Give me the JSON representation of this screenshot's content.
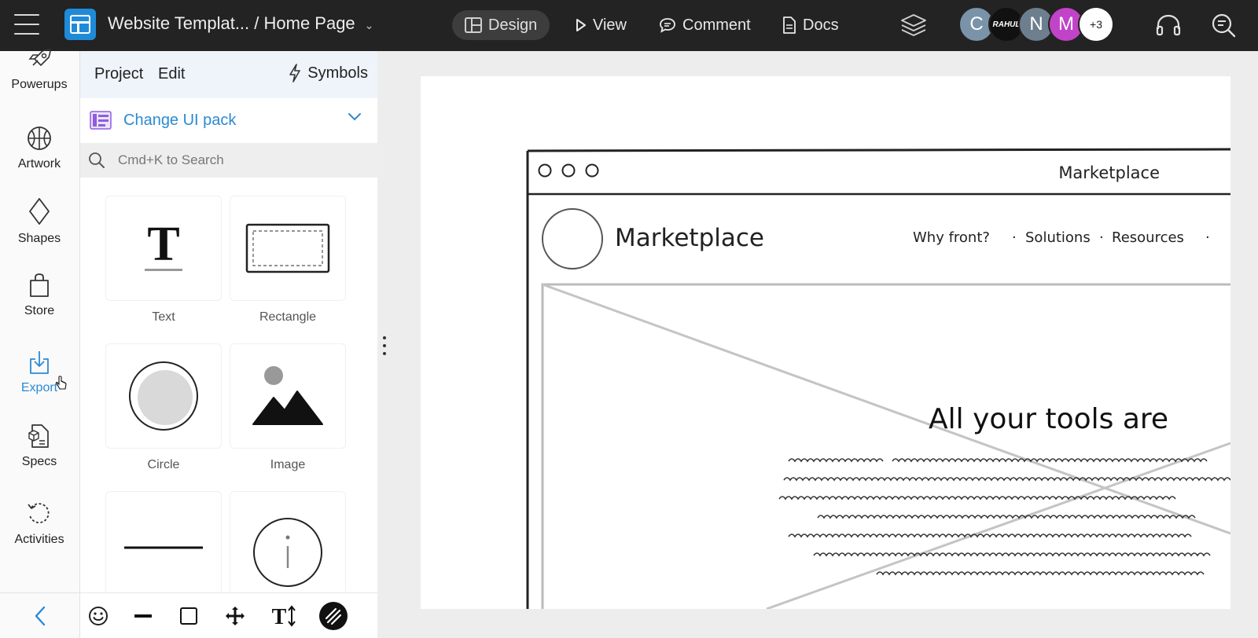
{
  "topbar": {
    "doc_title": "Website Templat... / Home Page",
    "modes": [
      {
        "label": "Design",
        "icon": "layout-icon"
      },
      {
        "label": "View",
        "icon": "play-icon"
      },
      {
        "label": "Comment",
        "icon": "comment-icon"
      },
      {
        "label": "Docs",
        "icon": "document-icon"
      }
    ],
    "avatars": [
      {
        "initial": "C",
        "color": "#7a93a8"
      },
      {
        "initial": "RAHUL",
        "color": "#111111"
      },
      {
        "initial": "N",
        "color": "#6d7f8f"
      },
      {
        "initial": "M",
        "color": "#c143c8"
      }
    ],
    "more_avatars": "+3"
  },
  "rail": {
    "items": [
      {
        "label": "Powerups",
        "icon": "rocket-icon"
      },
      {
        "label": "Artwork",
        "icon": "basketball-icon"
      },
      {
        "label": "Shapes",
        "icon": "diamond-icon"
      },
      {
        "label": "Store",
        "icon": "shopping-bag-icon"
      },
      {
        "label": "Export",
        "icon": "export-icon"
      },
      {
        "label": "Specs",
        "icon": "specs-icon"
      },
      {
        "label": "Activities",
        "icon": "history-icon"
      }
    ]
  },
  "panel": {
    "tabs": [
      "Project",
      "Edit"
    ],
    "symbols_label": "Symbols",
    "ui_pack_label": "Change UI pack",
    "search_placeholder": "Cmd+K to Search",
    "tiles": [
      {
        "label": "Text"
      },
      {
        "label": "Rectangle"
      },
      {
        "label": "Circle"
      },
      {
        "label": "Image"
      },
      {
        "label": ""
      },
      {
        "label": ""
      }
    ]
  },
  "canvas": {
    "window_title": "Marketplace",
    "logo_text": "Marketplace",
    "nav_links": [
      "Why front?",
      "Solutions",
      "Resources"
    ],
    "hero_heading": "All your tools are"
  },
  "colors": {
    "topbar_bg": "#232323",
    "accent": "#2b8ad3",
    "panel_tab_bg": "#eef4fa"
  }
}
